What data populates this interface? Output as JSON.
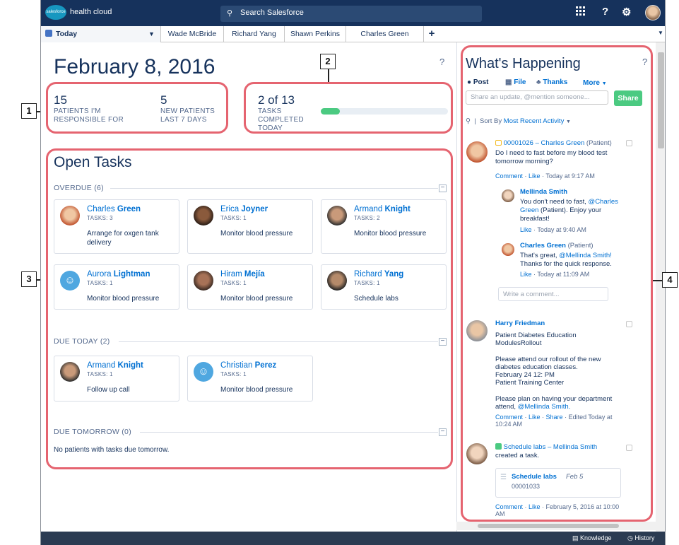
{
  "topbar": {
    "logo_text": "salesforce",
    "product_name": "health cloud",
    "search_placeholder": "Search Salesforce",
    "icons": [
      "apps-grid-icon",
      "help-icon",
      "setup-gear-icon",
      "user-avatar"
    ],
    "help_glyph": "?"
  },
  "tabs": {
    "today": "Today",
    "items": [
      "Wade McBride",
      "Richard Yang",
      "Shawn Perkins",
      "Charles Green"
    ],
    "add_glyph": "+"
  },
  "today": {
    "date": "February 8, 2016",
    "help_glyph": "?",
    "stat1": {
      "value": "15",
      "label_line1": "PATIENTS I'M",
      "label_line2": "RESPONSIBLE FOR"
    },
    "stat2": {
      "value": "5",
      "label_line1": "NEW PATIENTS",
      "label_line2": "LAST 7 DAYS"
    },
    "stat3": {
      "value": "2 of 13",
      "label_line1": "TASKS",
      "label_line2": "COMPLETED",
      "label_line3": "TODAY",
      "progress_fraction": 0.154
    }
  },
  "open_tasks": {
    "title": "Open Tasks",
    "overdue": {
      "header": "OVERDUE (6)",
      "cards": [
        {
          "first": "Charles",
          "last": "Green",
          "tasks": "TASKS: 3",
          "desc": "Arrange for oxgen tank delivery"
        },
        {
          "first": "Erica",
          "last": "Joyner",
          "tasks": "TASKS: 1",
          "desc": "Monitor blood pressure"
        },
        {
          "first": "Armand",
          "last": "Knight",
          "tasks": "TASKS: 2",
          "desc": "Monitor blood pressure"
        },
        {
          "first": "Aurora",
          "last": "Lightman",
          "tasks": "TASKS: 1",
          "desc": "Monitor blood pressure"
        },
        {
          "first": "Hiram",
          "last": "Mejía",
          "tasks": "TASKS: 1",
          "desc": "Monitor blood pressure"
        },
        {
          "first": "Richard",
          "last": "Yang",
          "tasks": "TASKS: 1",
          "desc": "Schedule labs"
        }
      ]
    },
    "due_today": {
      "header": "DUE TODAY (2)",
      "cards": [
        {
          "first": "Armand",
          "last": "Knight",
          "tasks": "TASKS: 1",
          "desc": "Follow up call"
        },
        {
          "first": "Christian",
          "last": "Perez",
          "tasks": "TASKS: 1",
          "desc": "Monitor blood pressure"
        }
      ]
    },
    "due_tomorrow": {
      "header": "DUE TOMORROW (0)",
      "empty_text": "No patients with tasks due tomorrow."
    },
    "collapse_glyph": "−"
  },
  "feed": {
    "title": "What's Happening",
    "help_glyph": "?",
    "publisher": {
      "post": "Post",
      "file": "File",
      "thanks": "Thanks",
      "more": "More",
      "placeholder": "Share an update, @mention someone...",
      "share": "Share"
    },
    "sort_prefix": "Sort By",
    "sort_value": "Most Recent Activity",
    "post1": {
      "record": "00001026",
      "sep": "–",
      "patient": "Charles Green",
      "patient_tag": "(Patient)",
      "body": [
        "Do I need to fast before my blood test",
        "tomorrow morning?"
      ],
      "comment": "Comment",
      "like": "Like",
      "time": "Today at 9:17 AM"
    },
    "reply1": {
      "author": "Mellinda Smith",
      "body1": "You don't need to fast,",
      "mention1": "@Charles",
      "mention2": "Green",
      "body2": "(Patient). Enjoy your",
      "body3": "breakfast!",
      "like": "Like",
      "time": "Today at 9:40 AM"
    },
    "reply2": {
      "author": "Charles Green",
      "author_tag": "(Patient)",
      "body1": "That's great,",
      "mention": "@Mellinda Smith!",
      "body2": "Thanks for the quick response.",
      "like": "Like",
      "time": "Today at 11:09 AM"
    },
    "comment_placeholder": "Write a comment...",
    "post2": {
      "author": "Harry Friedman",
      "lines": [
        "Patient Diabetes Education",
        "ModulesRollout",
        "",
        "Please attend our rollout of the new",
        "diabetes education classes.",
        "February 24 12: PM",
        "Patient Training Center",
        "",
        "Please plan on having your department",
        "attend,"
      ],
      "mention": "@Mellinda Smith.",
      "comment": "Comment",
      "like": "Like",
      "share": "Share",
      "edited": "Edited Today at",
      "edited_time": "10:24 AM"
    },
    "post3": {
      "title": "Schedule labs",
      "sep": "–",
      "author": "Mellinda Smith",
      "action": "created a task.",
      "task_title": "Schedule labs",
      "task_date": "Feb 5",
      "task_number": "00001033",
      "comment": "Comment",
      "like": "Like",
      "time": "February 5, 2016 at 10:00",
      "time2": "AM"
    }
  },
  "bottombar": {
    "knowledge": "Knowledge",
    "history": "History"
  },
  "callouts": {
    "c1": "1",
    "c2": "2",
    "c3": "3",
    "c4": "4"
  },
  "colors": {
    "nav": "#16325c",
    "link": "#0070d2",
    "success": "#4bca81",
    "callout": "#e56470"
  }
}
